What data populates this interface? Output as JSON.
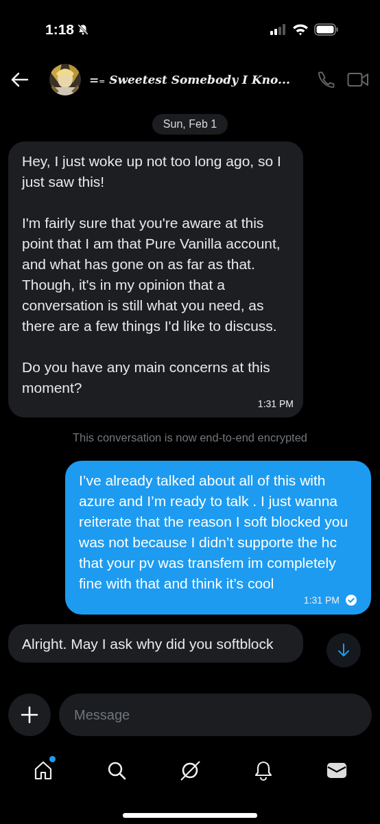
{
  "status_bar": {
    "time": "1:18",
    "silent": true
  },
  "header": {
    "title": "=₌ Sweetest Somebody I Kno..."
  },
  "date_label": "Sun, Feb 1",
  "messages": [
    {
      "kind": "incoming",
      "text": "Hey, I just woke up not too long ago, so I just saw this!\n\nI'm fairly sure that you're aware at this point that I am that Pure Vanilla account, and what has gone on as far as that. Though, it's in my opinion that a conversation is still what you need, as there are a few things I'd like to discuss.\n\nDo you have any main concerns at this moment?",
      "time": "1:31 PM"
    },
    {
      "kind": "notice",
      "text": "This conversation is now end-to-end encrypted"
    },
    {
      "kind": "outgoing",
      "text": "I’ve already talked about all of this with azure and I’m ready to talk . I just wanna reiterate that the reason I soft blocked you was not because I didn’t supporte the hc that your pv was transfem im completely fine with that and think it’s cool",
      "time": "1:31 PM",
      "read": true
    },
    {
      "kind": "incoming",
      "text": "Alright. May I ask why did you softblock"
    }
  ],
  "composer": {
    "placeholder": "Message"
  },
  "tabs": [
    {
      "kind": "home",
      "selected": false,
      "dot": true
    },
    {
      "kind": "search",
      "selected": false,
      "dot": false
    },
    {
      "kind": "grok",
      "selected": false,
      "dot": false
    },
    {
      "kind": "notifications",
      "selected": false,
      "dot": false
    },
    {
      "kind": "messages",
      "selected": true,
      "dot": false
    }
  ]
}
